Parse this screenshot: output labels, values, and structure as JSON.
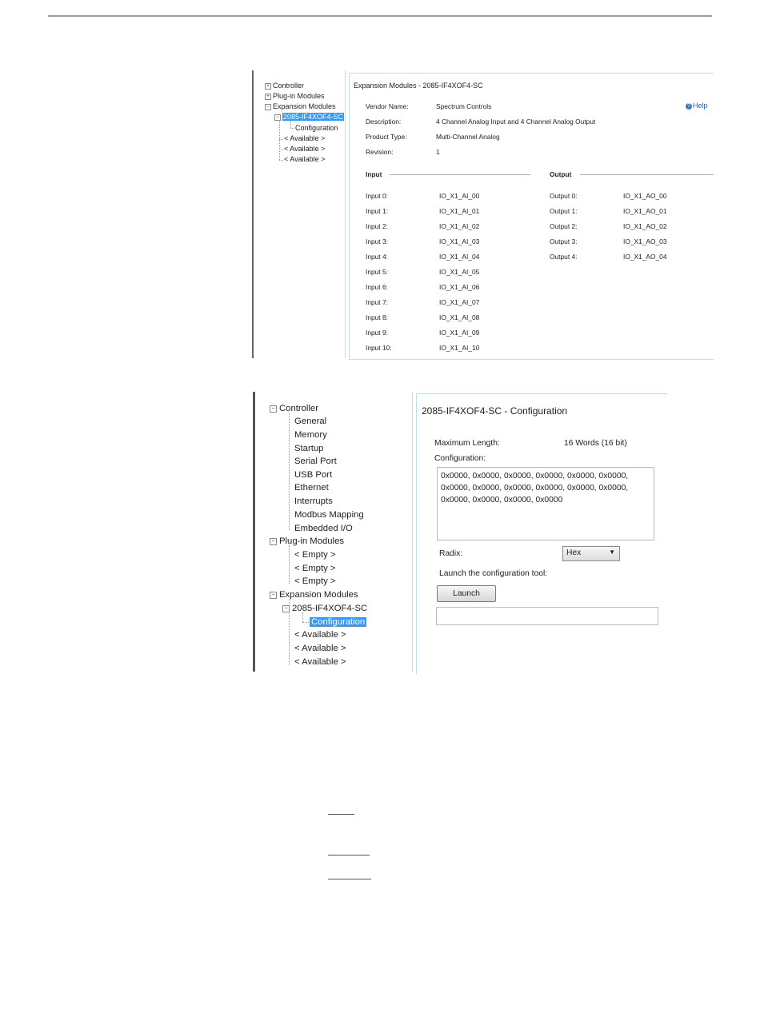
{
  "screenshot1": {
    "tree": {
      "items": [
        {
          "label": "Controller",
          "toggle": "+"
        },
        {
          "label": "Plug-in Modules",
          "toggle": "+"
        },
        {
          "label": "Expansion Modules",
          "toggle": "−"
        },
        {
          "label": "2085-IF4XOF4-SC",
          "toggle": "−"
        },
        {
          "label": "Configuration"
        },
        {
          "label": "< Available >"
        },
        {
          "label": "< Available >"
        },
        {
          "label": "< Available >"
        }
      ]
    },
    "title": "Expansion Modules - 2085-IF4XOF4-SC",
    "help_label": "Help",
    "help_icon": "?",
    "details": [
      {
        "key": "Vendor Name:",
        "value": "Spectrum Controls"
      },
      {
        "key": "Description:",
        "value": "4 Channel Analog Input and 4 Channel Analog Output"
      },
      {
        "key": "Product Type:",
        "value": "Multi-Channel Analog"
      },
      {
        "key": "Revision:",
        "value": "1"
      }
    ],
    "input_heading": "Input",
    "output_heading": "Output",
    "inputs": [
      {
        "label": "Input 0:",
        "tag": "IO_X1_AI_00"
      },
      {
        "label": "Input 1:",
        "tag": "IO_X1_AI_01"
      },
      {
        "label": "Input 2:",
        "tag": "IO_X1_AI_02"
      },
      {
        "label": "Input 3:",
        "tag": "IO_X1_AI_03"
      },
      {
        "label": "Input 4:",
        "tag": "IO_X1_AI_04"
      },
      {
        "label": "Input 5:",
        "tag": "IO_X1_AI_05"
      },
      {
        "label": "Input 6:",
        "tag": "IO_X1_AI_06"
      },
      {
        "label": "Input 7:",
        "tag": "IO_X1_AI_07"
      },
      {
        "label": "Input 8:",
        "tag": "IO_X1_AI_08"
      },
      {
        "label": "Input 9:",
        "tag": "IO_X1_AI_09"
      },
      {
        "label": "Input 10:",
        "tag": "IO_X1_AI_10"
      }
    ],
    "outputs": [
      {
        "label": "Output 0:",
        "tag": "IO_X1_AO_00"
      },
      {
        "label": "Output 1:",
        "tag": "IO_X1_AO_01"
      },
      {
        "label": "Output 2:",
        "tag": "IO_X1_AO_02"
      },
      {
        "label": "Output 3:",
        "tag": "IO_X1_AO_03"
      },
      {
        "label": "Output 4:",
        "tag": "IO_X1_AO_04"
      }
    ]
  },
  "screenshot2": {
    "tree": {
      "items": [
        {
          "label": "Controller",
          "toggle": "−"
        },
        {
          "label": "General"
        },
        {
          "label": "Memory"
        },
        {
          "label": "Startup"
        },
        {
          "label": "Serial Port"
        },
        {
          "label": "USB Port"
        },
        {
          "label": "Ethernet"
        },
        {
          "label": "Interrupts"
        },
        {
          "label": "Modbus Mapping"
        },
        {
          "label": "Embedded I/O"
        },
        {
          "label": "Plug-in Modules",
          "toggle": "−"
        },
        {
          "label": "< Empty >"
        },
        {
          "label": "< Empty >"
        },
        {
          "label": "< Empty >"
        },
        {
          "label": "Expansion Modules",
          "toggle": "−"
        },
        {
          "label": "2085-IF4XOF4-SC",
          "toggle": "−"
        },
        {
          "label": "Configuration"
        },
        {
          "label": "< Available >"
        },
        {
          "label": "< Available >"
        },
        {
          "label": "< Available >"
        }
      ]
    },
    "title": "2085-IF4XOF4-SC - Configuration",
    "max_length_label": "Maximum Length:",
    "max_length_value": "16  Words (16 bit)",
    "configuration_label": "Configuration:",
    "configuration_value": "0x0000, 0x0000, 0x0000, 0x0000, 0x0000, 0x0000,\n0x0000, 0x0000, 0x0000, 0x0000, 0x0000, 0x0000,\n0x0000, 0x0000, 0x0000, 0x0000",
    "radix_label": "Radix:",
    "radix_value": "Hex",
    "launch_text": "Launch the configuration tool:",
    "launch_button": "Launch",
    "selection_color": "#3399ff"
  }
}
